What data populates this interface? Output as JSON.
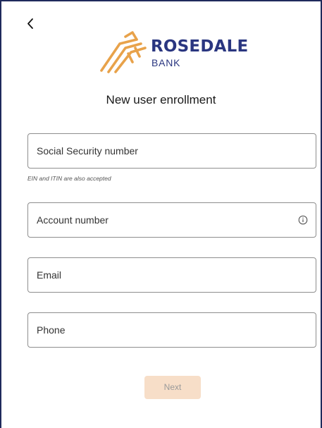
{
  "header": {
    "back_icon": "chevron-left-icon",
    "logo": {
      "brand_name": "ROSEDALE",
      "brand_sub": "BANK",
      "mark_color": "#e8a24a",
      "text_color": "#2a3680"
    },
    "title": "New user enrollment"
  },
  "form": {
    "ssn": {
      "placeholder": "Social Security number",
      "value": "",
      "helper": "EIN and ITIN are also accepted"
    },
    "account": {
      "placeholder": "Account number",
      "value": "",
      "info_icon": "info-icon"
    },
    "email": {
      "placeholder": "Email",
      "value": ""
    },
    "phone": {
      "placeholder": "Phone",
      "value": ""
    },
    "next_label": "Next",
    "next_color": "#f7dec8"
  }
}
